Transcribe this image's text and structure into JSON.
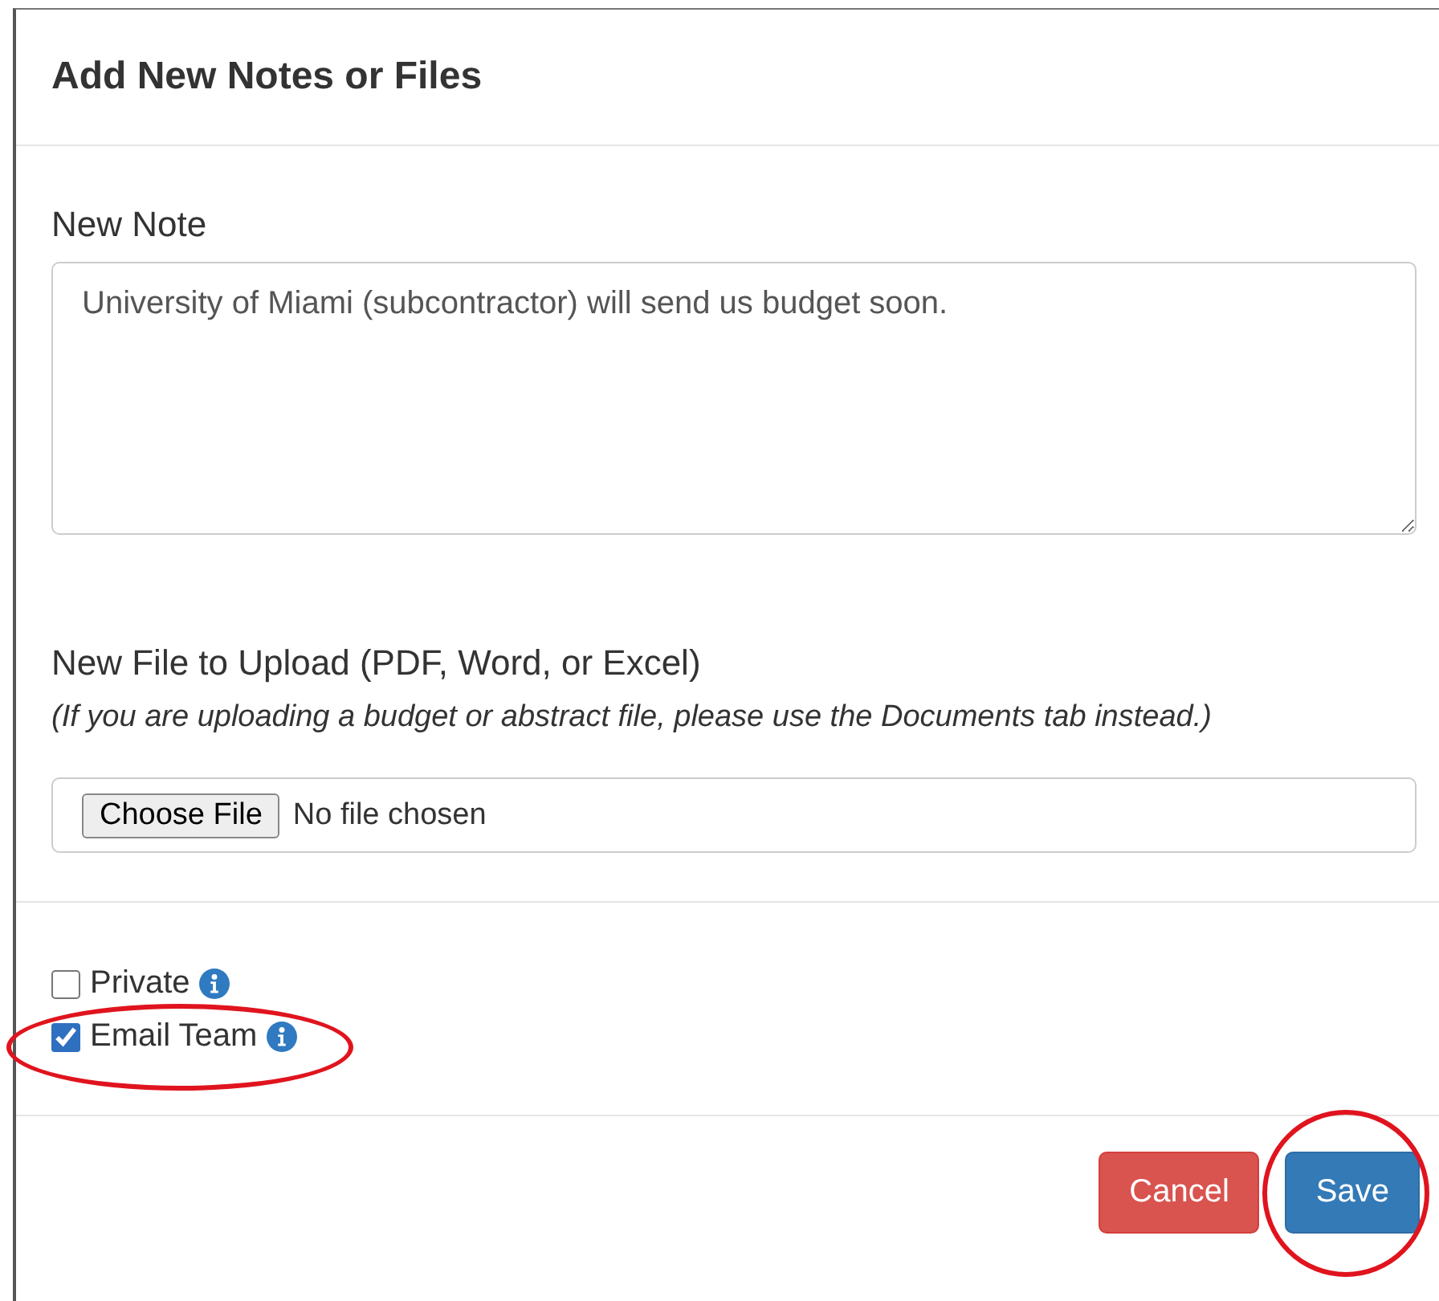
{
  "dialog": {
    "title": "Add New Notes or Files"
  },
  "note": {
    "label": "New Note",
    "value": "University of Miami (subcontractor) will send us budget soon."
  },
  "file": {
    "label": "New File to Upload (PDF, Word, or Excel)",
    "hint": "(If you are uploading a budget or abstract file, please use the Documents tab instead.)",
    "button": "Choose File",
    "status": "No file chosen"
  },
  "options": [
    {
      "label": "Private",
      "checked": false,
      "circled": false
    },
    {
      "label": "Email Team",
      "checked": true,
      "circled": true
    }
  ],
  "buttons": [
    {
      "label": "Cancel",
      "kind": "danger",
      "circled": false
    },
    {
      "label": "Save",
      "kind": "primary",
      "circled": true
    }
  ]
}
